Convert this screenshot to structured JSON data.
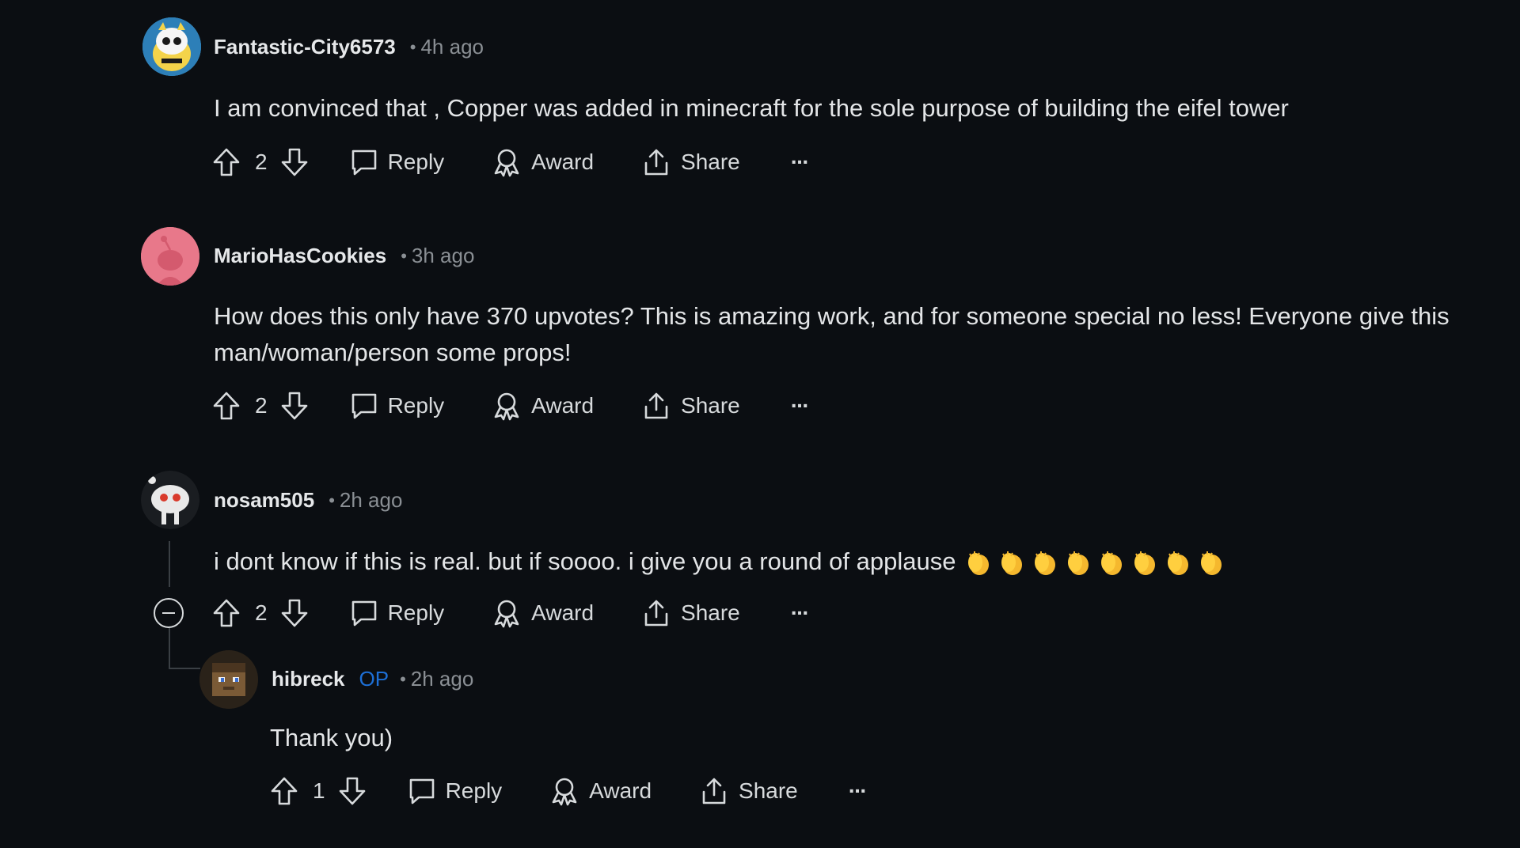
{
  "comments": [
    {
      "username": "Fantastic-City6573",
      "separator": "•",
      "time": "4h ago",
      "body": "I am convinced that , Copper was added in minecraft for the sole purpose of building the eifel tower",
      "votes": "2",
      "actions": {
        "reply": "Reply",
        "award": "Award",
        "share": "Share",
        "more": "···"
      }
    },
    {
      "username": "MarioHasCookies",
      "separator": "•",
      "time": "3h ago",
      "body": "How does this only have 370 upvotes? This is amazing work, and for someone special no less! Everyone give this man/woman/person some props!",
      "votes": "2",
      "actions": {
        "reply": "Reply",
        "award": "Award",
        "share": "Share",
        "more": "···"
      }
    },
    {
      "username": "nosam505",
      "separator": "•",
      "time": "2h ago",
      "body": "i dont know if this is real. but if soooo. i give you a round of applause",
      "emoji": "👏👏👏👏👏👏👏👏",
      "votes": "2",
      "actions": {
        "reply": "Reply",
        "award": "Award",
        "share": "Share",
        "more": "···"
      }
    },
    {
      "username": "hibreck",
      "badge": "OP",
      "separator": "•",
      "time": "2h ago",
      "body": "Thank you)",
      "votes": "1",
      "actions": {
        "reply": "Reply",
        "award": "Award",
        "share": "Share",
        "more": "···"
      }
    }
  ],
  "colors": {
    "background": "#0b0e12",
    "text": "#d7dadc",
    "muted": "#8a8f94",
    "op_badge": "#1d6fd6",
    "avatar_pink": "#e8788a"
  }
}
